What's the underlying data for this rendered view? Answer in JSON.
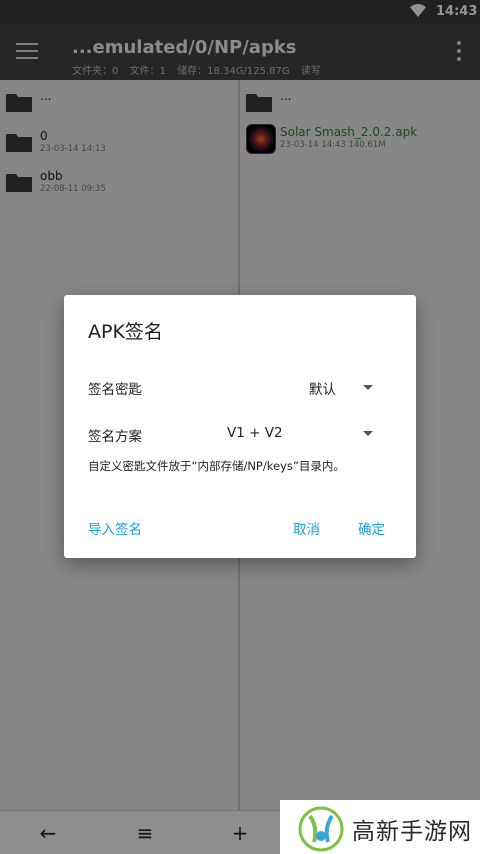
{
  "status": {
    "time": "14:43"
  },
  "toolbar": {
    "path": "...emulated/0/NP/apks",
    "meta": {
      "folders": "文件夹：0",
      "files": "文件：1",
      "storage": "储存：18.34G/125.87G",
      "mode": "读写"
    }
  },
  "left_pane": {
    "items": [
      {
        "name": "...",
        "date": ""
      },
      {
        "name": "0",
        "date": "23-03-14 14:13"
      },
      {
        "name": "obb",
        "date": "22-08-11 09:35"
      }
    ]
  },
  "right_pane": {
    "items": [
      {
        "name": "...",
        "date": ""
      },
      {
        "name": "Solar Smash_2.0.2.apk",
        "date": "23-03-14 14:43  140.61M"
      }
    ]
  },
  "dialog": {
    "title": "APK签名",
    "key_label": "签名密匙",
    "key_value": "默认",
    "scheme_label": "签名方案",
    "scheme_value": "V1 + V2",
    "hint": "自定义密匙文件放于“内部存储/NP/keys”目录内。",
    "import_label": "导入签名",
    "cancel_label": "取消",
    "ok_label": "确定"
  },
  "bottom": {
    "back": "←",
    "list": "≡",
    "add": "+"
  },
  "watermark": {
    "text": "高新手游网"
  },
  "colors": {
    "accent": "#1da1d6",
    "apk_name": "#2e7d32",
    "toolbar": "#424242"
  }
}
